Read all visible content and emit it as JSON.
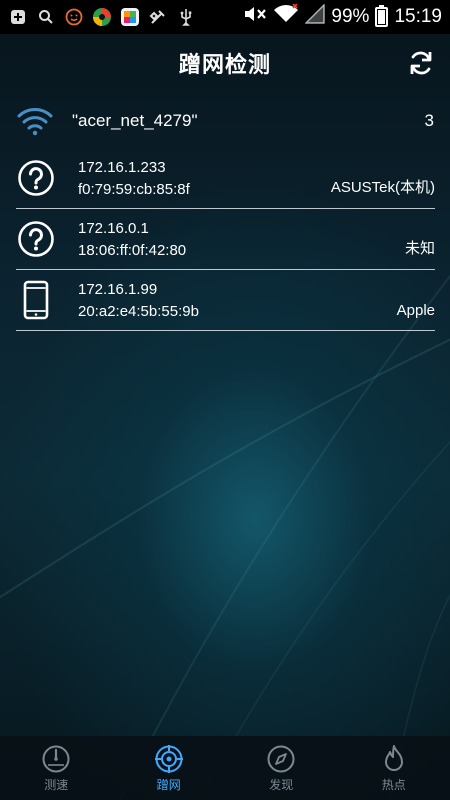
{
  "status_bar": {
    "battery": "99%",
    "time": "15:19"
  },
  "header": {
    "title": "蹭网检测"
  },
  "network": {
    "ssid": "\"acer_net_4279\"",
    "device_count": "3"
  },
  "devices": [
    {
      "ip": "172.16.1.233",
      "mac": "f0:79:59:cb:85:8f",
      "vendor": "ASUSTek(本机)",
      "icon": "question-icon"
    },
    {
      "ip": "172.16.0.1",
      "mac": "18:06:ff:0f:42:80",
      "vendor": "未知",
      "icon": "question-icon"
    },
    {
      "ip": "172.16.1.99",
      "mac": "20:a2:e4:5b:55:9b",
      "vendor": "Apple",
      "icon": "phone-icon"
    }
  ],
  "bottom_nav": {
    "tabs": [
      {
        "label": "测速",
        "icon": "speedometer-icon"
      },
      {
        "label": "蹭网",
        "icon": "target-icon",
        "active": true
      },
      {
        "label": "发现",
        "icon": "compass-icon"
      },
      {
        "label": "热点",
        "icon": "flame-icon"
      }
    ]
  },
  "colors": {
    "accent": "#3fa9ff",
    "inactive": "#7d8790",
    "divider": "#dce6eb"
  }
}
